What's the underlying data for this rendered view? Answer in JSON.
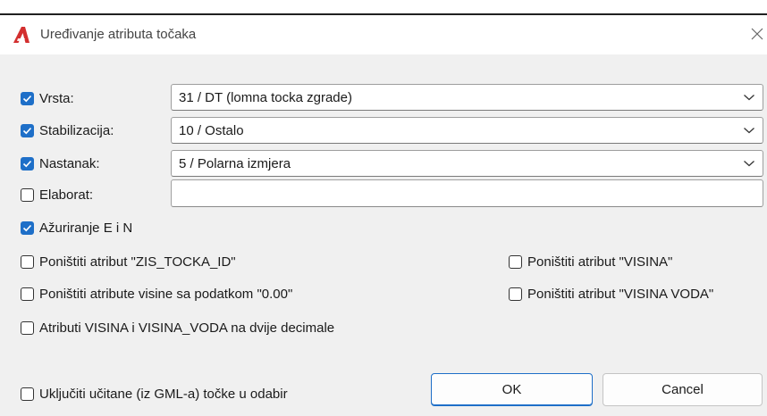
{
  "window": {
    "title": "Uređivanje atributa točaka"
  },
  "fields": {
    "vrsta": {
      "label": "Vrsta:",
      "checked": true,
      "value": "31 / DT (lomna tocka zgrade)"
    },
    "stabilizacija": {
      "label": "Stabilizacija:",
      "checked": true,
      "value": "10 / Ostalo"
    },
    "nastanak": {
      "label": "Nastanak:",
      "checked": true,
      "value": "5 / Polarna izmjera"
    },
    "elaborat": {
      "label": "Elaborat:",
      "checked": false,
      "value": ""
    }
  },
  "options": {
    "azuriranje": {
      "label": "Ažuriranje E i N",
      "checked": true
    },
    "ponistiti_zis": {
      "label": "Poništiti atribut \"ZIS_TOCKA_ID\"",
      "checked": false
    },
    "ponistiti_visina": {
      "label": "Poništiti atribut \"VISINA\"",
      "checked": false
    },
    "ponistiti_visine_000": {
      "label": "Poništiti atribute visine sa podatkom \"0.00\"",
      "checked": false
    },
    "ponistiti_visina_voda": {
      "label": "Poništiti atribut \"VISINA VODA\"",
      "checked": false
    },
    "dvije_decimale": {
      "label": "Atributi VISINA i VISINA_VODA na dvije decimale",
      "checked": false
    },
    "ukljuciti_gml": {
      "label": "Uključiti učitane (iz GML-a) točke u odabir",
      "checked": false
    }
  },
  "buttons": {
    "ok": "OK",
    "cancel": "Cancel"
  },
  "colors": {
    "accent": "#1e6fc8",
    "app_icon": "#d32f2f"
  }
}
